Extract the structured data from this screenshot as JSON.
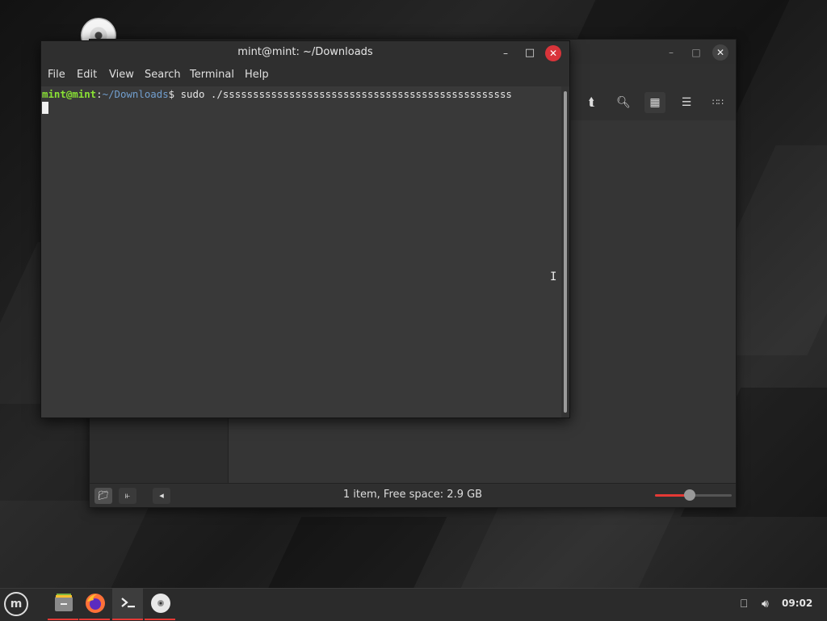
{
  "terminal": {
    "title": "mint@mint: ~/Downloads",
    "menu": [
      "File",
      "Edit",
      "View",
      "Search",
      "Terminal",
      "Help"
    ],
    "prompt_user": "mint@mint",
    "prompt_sep": ":",
    "prompt_path": "~/Downloads",
    "prompt_symbol": "$",
    "command": " sudo ./ssssssssssssssssssssssssssssssssssssssssssssssss"
  },
  "file_manager": {
    "status": "1 item, Free space: 2.9 GB",
    "zoom_level": 0.45
  },
  "taskbar": {
    "clock": "09:02"
  },
  "icons": {
    "menu": "linux-mint-logo",
    "apps": [
      "files-icon",
      "firefox-icon",
      "terminal-icon",
      "disc-icon"
    ],
    "tray": [
      "network-icon",
      "volume-icon"
    ]
  },
  "colors": {
    "accent": "#e53935",
    "prompt_user": "#8ae234",
    "prompt_path": "#729fcf",
    "close_button": "#d9343a"
  }
}
